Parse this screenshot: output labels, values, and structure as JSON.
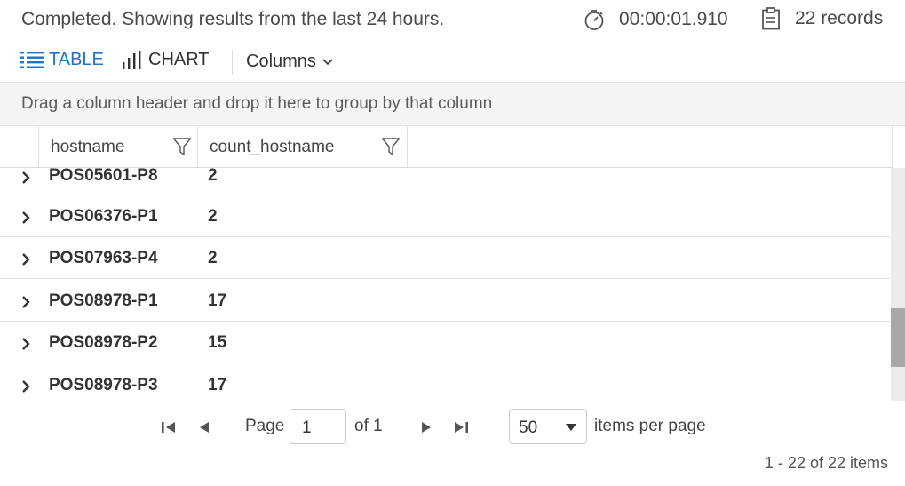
{
  "status": {
    "message": "Completed. Showing results from the last 24 hours.",
    "elapsed": "00:00:01.910",
    "records": "22 records"
  },
  "tabs": {
    "table_label": "TABLE",
    "chart_label": "CHART",
    "columns_label": "Columns"
  },
  "group_panel": {
    "hint": "Drag a column header and drop it here to group by that column"
  },
  "grid": {
    "columns": [
      "hostname",
      "count_hostname"
    ],
    "rows": [
      {
        "hostname": "POS05601-P8",
        "count": "2"
      },
      {
        "hostname": "POS06376-P1",
        "count": "2"
      },
      {
        "hostname": "POS07963-P4",
        "count": "2"
      },
      {
        "hostname": "POS08978-P1",
        "count": "17"
      },
      {
        "hostname": "POS08978-P2",
        "count": "15"
      },
      {
        "hostname": "POS08978-P3",
        "count": "17"
      }
    ]
  },
  "pager": {
    "page_label": "Page",
    "page_value": "1",
    "of_label": "of 1",
    "per_page_value": "50",
    "items_per_page_label": "items per page",
    "range": "1 - 22 of 22 items"
  },
  "colors": {
    "accent": "#1b73c9",
    "group_panel_bg": "#f4f4f4",
    "scroll_thumb": "#a8a8a8"
  },
  "icons": [
    "stopwatch-icon",
    "clipboard-icon",
    "table-list-icon",
    "bar-chart-icon",
    "chevron-down-icon",
    "filter-icon",
    "expand-arrow-icon",
    "first-page-icon",
    "prev-page-icon",
    "next-page-icon",
    "last-page-icon",
    "dropdown-caret-icon"
  ]
}
